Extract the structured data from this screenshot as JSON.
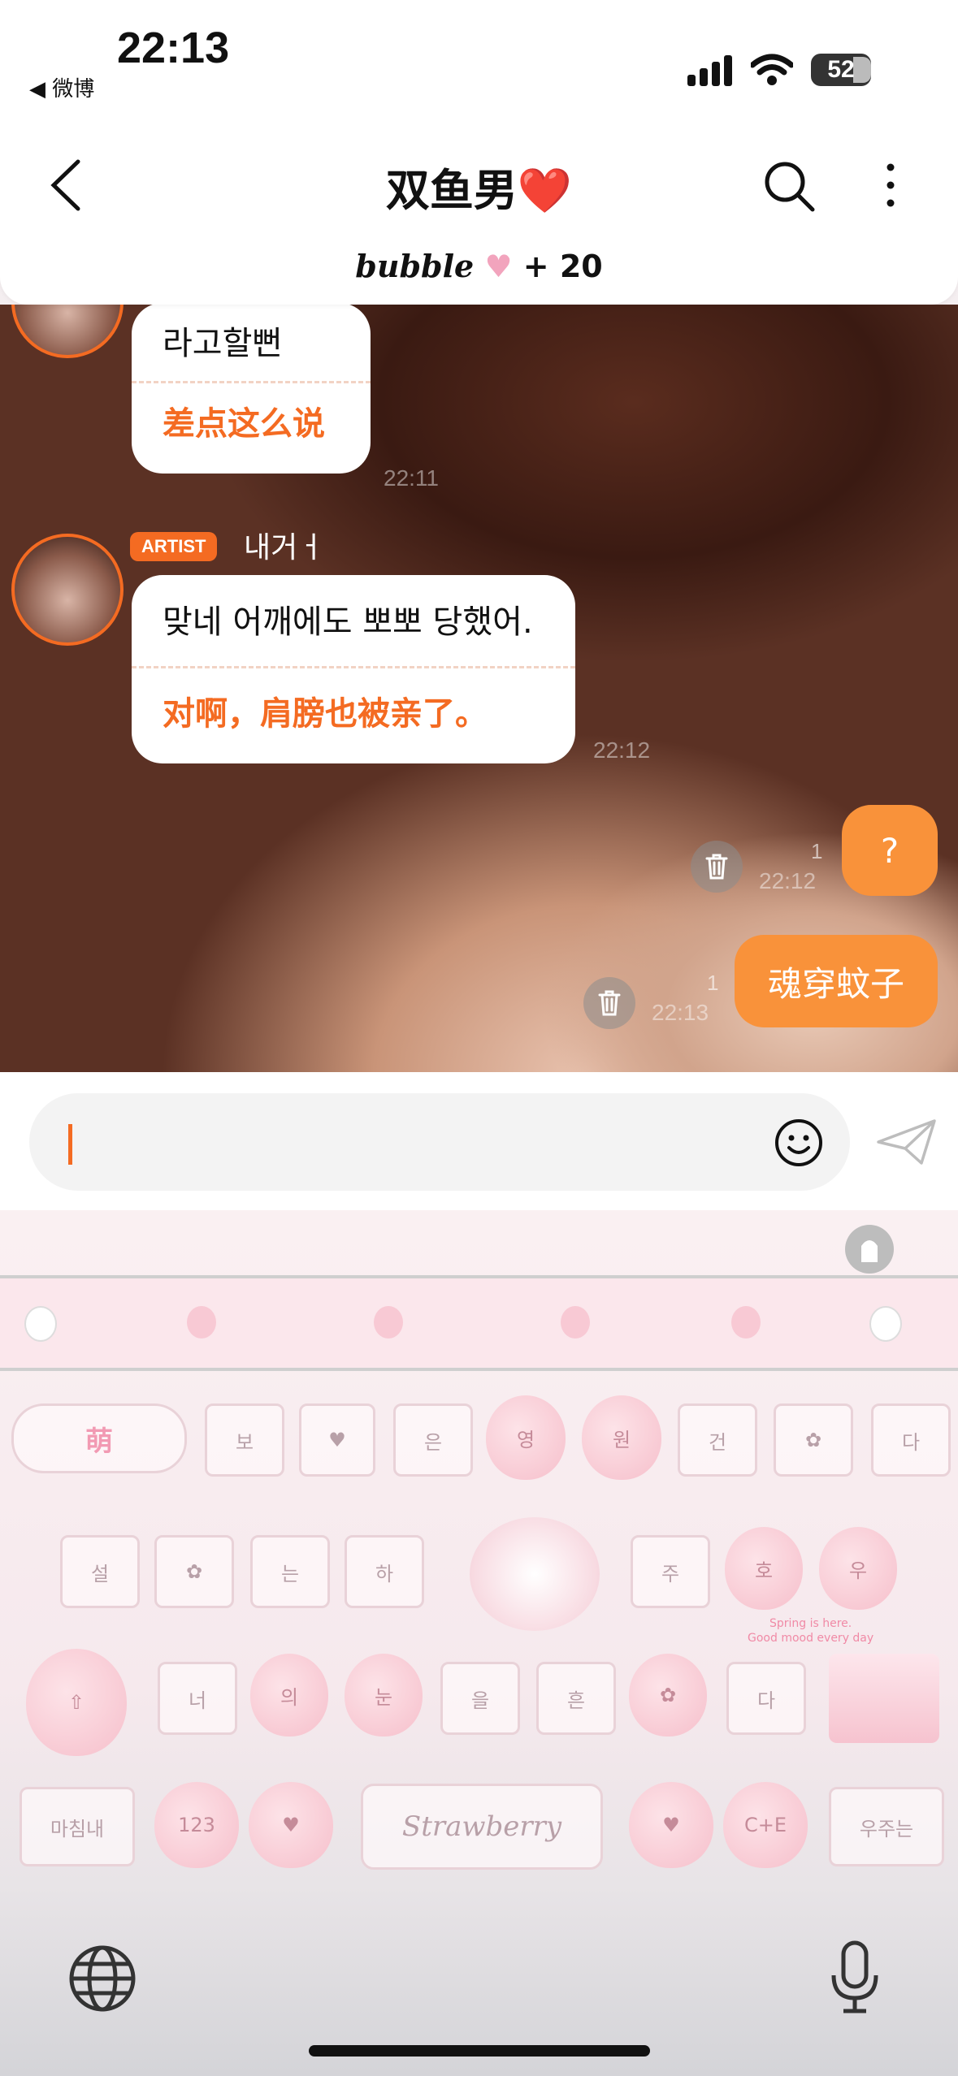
{
  "status_bar": {
    "time": "22:13",
    "back_app": "微博",
    "battery": "52"
  },
  "header": {
    "title": "双鱼男",
    "title_emoji": "❤️",
    "subtitle_brand": "bubble",
    "subtitle_count": "+ 20"
  },
  "messages": [
    {
      "original": "라고할뻔",
      "translation": "差点这么说",
      "time": "22:11"
    },
    {
      "badge": "ARTIST",
      "sender": "내거ㅓ",
      "original": "맞네 어깨에도 뽀뽀 당했어.",
      "translation": "对啊，肩膀也被亲了。",
      "time": "22:12"
    }
  ],
  "my_messages": [
    {
      "text": "?",
      "read_count": "1",
      "time": "22:12"
    },
    {
      "text": "魂穿蚊子",
      "read_count": "1",
      "time": "22:13"
    }
  ],
  "input": {
    "placeholder": ""
  },
  "keyboard": {
    "row1": [
      "萌",
      "보",
      "은",
      "영",
      "원",
      "건",
      "다"
    ],
    "row2": [
      "설",
      "는",
      "하",
      "주",
      "호",
      "우"
    ],
    "row3": [
      "너",
      "의",
      "눈",
      "을",
      "흔",
      "다"
    ],
    "row4": [
      "마침내",
      "123",
      "Strawberry",
      "C+E",
      "우주는"
    ],
    "spring_text": [
      "Spring is here.",
      "Good mood every day"
    ]
  },
  "colors": {
    "accent": "#f46b22",
    "my_bubble": "#f9923a"
  }
}
